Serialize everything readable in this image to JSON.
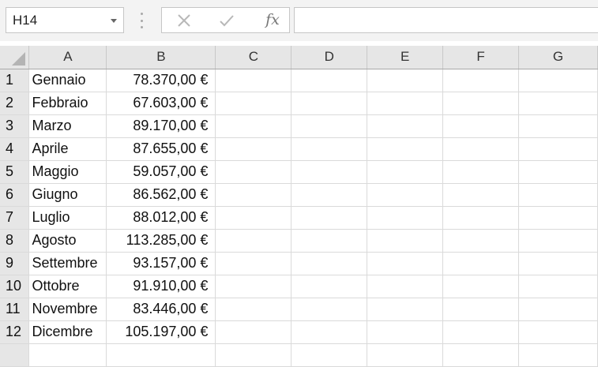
{
  "name_box": {
    "value": "H14"
  },
  "formula_bar": {
    "cancel_icon": "x-icon",
    "enter_icon": "check-icon",
    "function_label": "fx",
    "formula": ""
  },
  "columns": [
    "A",
    "B",
    "C",
    "D",
    "E",
    "F",
    "G"
  ],
  "rows": [
    {
      "num": "1",
      "a": "Gennaio",
      "b": "78.370,00 €"
    },
    {
      "num": "2",
      "a": "Febbraio",
      "b": "67.603,00 €"
    },
    {
      "num": "3",
      "a": "Marzo",
      "b": "89.170,00 €"
    },
    {
      "num": "4",
      "a": "Aprile",
      "b": "87.655,00 €"
    },
    {
      "num": "5",
      "a": "Maggio",
      "b": "59.057,00 €"
    },
    {
      "num": "6",
      "a": "Giugno",
      "b": "86.562,00 €"
    },
    {
      "num": "7",
      "a": "Luglio",
      "b": "88.012,00 €"
    },
    {
      "num": "8",
      "a": "Agosto",
      "b": "113.285,00 €"
    },
    {
      "num": "9",
      "a": "Settembre",
      "b": "93.157,00 €"
    },
    {
      "num": "10",
      "a": "Ottobre",
      "b": "91.910,00 €"
    },
    {
      "num": "11",
      "a": "Novembre",
      "b": "83.446,00 €"
    },
    {
      "num": "12",
      "a": "Dicembre",
      "b": "105.197,00 €"
    }
  ]
}
